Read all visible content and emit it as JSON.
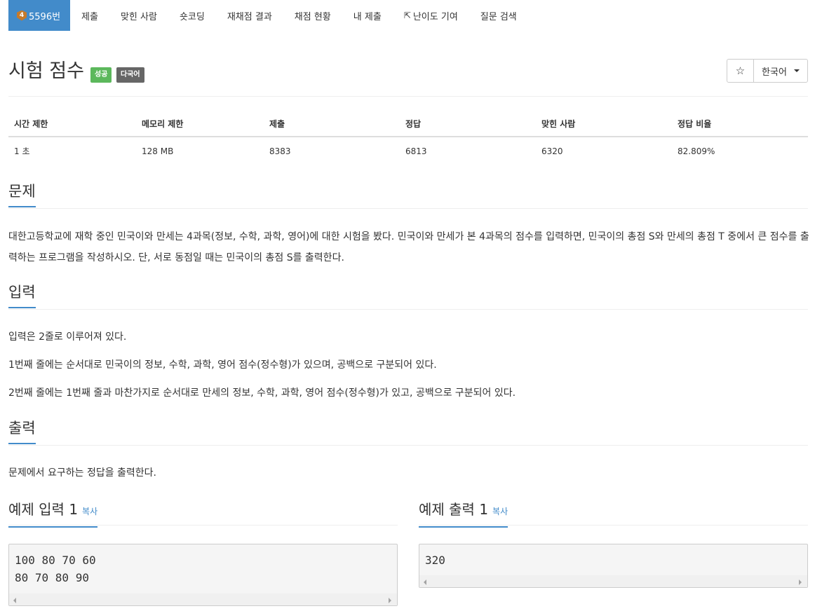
{
  "nav": {
    "tabs": [
      {
        "label": "5596번",
        "badge": "4",
        "active": true
      },
      {
        "label": "제출"
      },
      {
        "label": "맞힌 사람"
      },
      {
        "label": "숏코딩"
      },
      {
        "label": "재채점 결과"
      },
      {
        "label": "채점 현황"
      },
      {
        "label": "내 제출"
      },
      {
        "label": "난이도 기여",
        "icon": "external-link-icon"
      },
      {
        "label": "질문 검색"
      }
    ]
  },
  "problem": {
    "title": "시험 점수",
    "labels": {
      "success": "성공",
      "multi": "다국어"
    },
    "star": "☆",
    "language": "한국어"
  },
  "info_table": {
    "headers": [
      "시간 제한",
      "메모리 제한",
      "제출",
      "정답",
      "맞힌 사람",
      "정답 비율"
    ],
    "values": [
      "1 초",
      "128 MB",
      "8383",
      "6813",
      "6320",
      "82.809%"
    ]
  },
  "sections": {
    "description": {
      "heading": "문제",
      "text": "대한고등학교에 재학 중인 민국이와 만세는 4과목(정보, 수학, 과학, 영어)에 대한 시험을 봤다. 민국이와 만세가 본 4과목의 점수를 입력하면, 민국이의 총점 S와 만세의 총점 T 중에서 큰 점수를 출력하는 프로그램을 작성하시오. 단, 서로 동점일 때는 민국이의 총점 S를 출력한다."
    },
    "input": {
      "heading": "입력",
      "lines": [
        "입력은 2줄로 이루어져 있다.",
        "1번째 줄에는 순서대로 민국이의 정보, 수학, 과학, 영어 점수(정수형)가 있으며, 공백으로 구분되어 있다.",
        "2번째 줄에는 1번째 줄과 마찬가지로 순서대로 만세의 정보, 수학, 과학, 영어 점수(정수형)가 있고, 공백으로 구분되어 있다."
      ]
    },
    "output": {
      "heading": "출력",
      "text": "문제에서 요구하는 정답을 출력한다."
    }
  },
  "samples": {
    "input": {
      "heading": "예제 입력 1",
      "copy": "복사",
      "code": "100 80 70 60\n80 70 80 90"
    },
    "output": {
      "heading": "예제 출력 1",
      "copy": "복사",
      "code": "320"
    }
  }
}
